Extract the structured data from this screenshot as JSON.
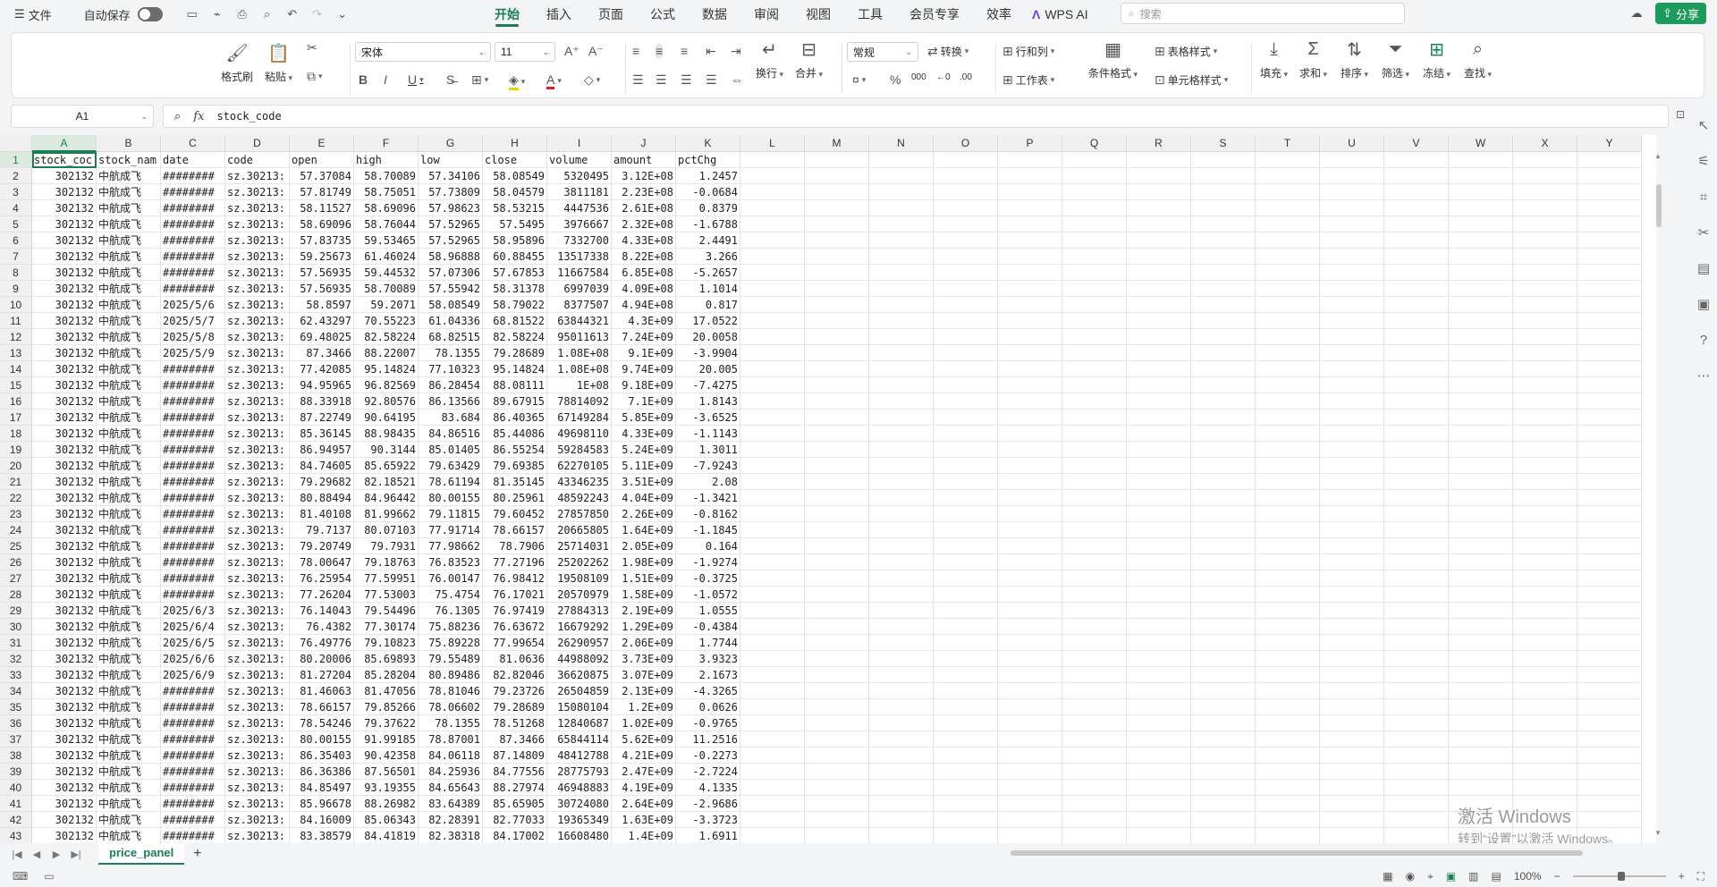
{
  "titlebar": {
    "file_menu": "文件",
    "autosave_label": "自动保存",
    "tabs": [
      "开始",
      "插入",
      "页面",
      "公式",
      "数据",
      "审阅",
      "视图",
      "工具",
      "会员专享",
      "效率"
    ],
    "wps_ai": "WPS AI",
    "search_placeholder": "搜索",
    "share": "分享"
  },
  "ribbon": {
    "format_painter": "格式刷",
    "paste": "粘贴",
    "font_name": "宋体",
    "font_size": "11",
    "bold": "B",
    "italic": "I",
    "underline": "U",
    "wrap": "换行",
    "merge": "合并",
    "number_format": "常规",
    "convert": "转换",
    "rows_cols": "行和列",
    "worksheet": "工作表",
    "table_style": "表格样式",
    "cond_format": "条件格式",
    "cell_style": "单元格样式",
    "fill": "填充",
    "sum": "求和",
    "sort": "排序",
    "filter": "筛选",
    "freeze": "冻结",
    "find": "查找",
    "percent": "%",
    "thousands": "000"
  },
  "formula_bar": {
    "cell_ref": "A1",
    "fx": "fx",
    "value": "stock_code"
  },
  "columns": [
    "A",
    "B",
    "C",
    "D",
    "E",
    "F",
    "G",
    "H",
    "I",
    "J",
    "K",
    "L",
    "M",
    "N",
    "O",
    "P",
    "Q",
    "R",
    "S",
    "T",
    "U",
    "V",
    "W",
    "X",
    "Y"
  ],
  "rows": [
    [
      "stock_coc",
      "stock_nam",
      "date",
      "code",
      "open",
      "high",
      "low",
      "close",
      "volume",
      "amount",
      "pctChg"
    ],
    [
      "302132",
      "中航成飞",
      "########",
      "sz.30213:",
      "57.37084",
      "58.70089",
      "57.34106",
      "58.08549",
      "5320495",
      "3.12E+08",
      "1.2457"
    ],
    [
      "302132",
      "中航成飞",
      "########",
      "sz.30213:",
      "57.81749",
      "58.75051",
      "57.73809",
      "58.04579",
      "3811181",
      "2.23E+08",
      "-0.0684"
    ],
    [
      "302132",
      "中航成飞",
      "########",
      "sz.30213:",
      "58.11527",
      "58.69096",
      "57.98623",
      "58.53215",
      "4447536",
      "2.61E+08",
      "0.8379"
    ],
    [
      "302132",
      "中航成飞",
      "########",
      "sz.30213:",
      "58.69096",
      "58.76044",
      "57.52965",
      "57.5495",
      "3976667",
      "2.32E+08",
      "-1.6788"
    ],
    [
      "302132",
      "中航成飞",
      "########",
      "sz.30213:",
      "57.83735",
      "59.53465",
      "57.52965",
      "58.95896",
      "7332700",
      "4.33E+08",
      "2.4491"
    ],
    [
      "302132",
      "中航成飞",
      "########",
      "sz.30213:",
      "59.25673",
      "61.46024",
      "58.96888",
      "60.88455",
      "13517338",
      "8.22E+08",
      "3.266"
    ],
    [
      "302132",
      "中航成飞",
      "########",
      "sz.30213:",
      "57.56935",
      "59.44532",
      "57.07306",
      "57.67853",
      "11667584",
      "6.85E+08",
      "-5.2657"
    ],
    [
      "302132",
      "中航成飞",
      "########",
      "sz.30213:",
      "57.56935",
      "58.70089",
      "57.55942",
      "58.31378",
      "6997039",
      "4.09E+08",
      "1.1014"
    ],
    [
      "302132",
      "中航成飞",
      "2025/5/6",
      "sz.30213:",
      "58.8597",
      "59.2071",
      "58.08549",
      "58.79022",
      "8377507",
      "4.94E+08",
      "0.817"
    ],
    [
      "302132",
      "中航成飞",
      "2025/5/7",
      "sz.30213:",
      "62.43297",
      "70.55223",
      "61.04336",
      "68.81522",
      "63844321",
      "4.3E+09",
      "17.0522"
    ],
    [
      "302132",
      "中航成飞",
      "2025/5/8",
      "sz.30213:",
      "69.48025",
      "82.58224",
      "68.82515",
      "82.58224",
      "95011613",
      "7.24E+09",
      "20.0058"
    ],
    [
      "302132",
      "中航成飞",
      "2025/5/9",
      "sz.30213:",
      "87.3466",
      "88.22007",
      "78.1355",
      "79.28689",
      "1.08E+08",
      "9.1E+09",
      "-3.9904"
    ],
    [
      "302132",
      "中航成飞",
      "########",
      "sz.30213:",
      "77.42085",
      "95.14824",
      "77.10323",
      "95.14824",
      "1.08E+08",
      "9.74E+09",
      "20.005"
    ],
    [
      "302132",
      "中航成飞",
      "########",
      "sz.30213:",
      "94.95965",
      "96.82569",
      "86.28454",
      "88.08111",
      "1E+08",
      "9.18E+09",
      "-7.4275"
    ],
    [
      "302132",
      "中航成飞",
      "########",
      "sz.30213:",
      "88.33918",
      "92.80576",
      "86.13566",
      "89.67915",
      "78814092",
      "7.1E+09",
      "1.8143"
    ],
    [
      "302132",
      "中航成飞",
      "########",
      "sz.30213:",
      "87.22749",
      "90.64195",
      "83.684",
      "86.40365",
      "67149284",
      "5.85E+09",
      "-3.6525"
    ],
    [
      "302132",
      "中航成飞",
      "########",
      "sz.30213:",
      "85.36145",
      "88.98435",
      "84.86516",
      "85.44086",
      "49698110",
      "4.33E+09",
      "-1.1143"
    ],
    [
      "302132",
      "中航成飞",
      "########",
      "sz.30213:",
      "86.94957",
      "90.3144",
      "85.01405",
      "86.55254",
      "59284583",
      "5.24E+09",
      "1.3011"
    ],
    [
      "302132",
      "中航成飞",
      "########",
      "sz.30213:",
      "84.74605",
      "85.65922",
      "79.63429",
      "79.69385",
      "62270105",
      "5.11E+09",
      "-7.9243"
    ],
    [
      "302132",
      "中航成飞",
      "########",
      "sz.30213:",
      "79.29682",
      "82.18521",
      "78.61194",
      "81.35145",
      "43346235",
      "3.51E+09",
      "2.08"
    ],
    [
      "302132",
      "中航成飞",
      "########",
      "sz.30213:",
      "80.88494",
      "84.96442",
      "80.00155",
      "80.25961",
      "48592243",
      "4.04E+09",
      "-1.3421"
    ],
    [
      "302132",
      "中航成飞",
      "########",
      "sz.30213:",
      "81.40108",
      "81.99662",
      "79.11815",
      "79.60452",
      "27857850",
      "2.26E+09",
      "-0.8162"
    ],
    [
      "302132",
      "中航成飞",
      "########",
      "sz.30213:",
      "79.7137",
      "80.07103",
      "77.91714",
      "78.66157",
      "20665805",
      "1.64E+09",
      "-1.1845"
    ],
    [
      "302132",
      "中航成飞",
      "########",
      "sz.30213:",
      "79.20749",
      "79.7931",
      "77.98662",
      "78.7906",
      "25714031",
      "2.05E+09",
      "0.164"
    ],
    [
      "302132",
      "中航成飞",
      "########",
      "sz.30213:",
      "78.00647",
      "79.18763",
      "76.83523",
      "77.27196",
      "25202262",
      "1.98E+09",
      "-1.9274"
    ],
    [
      "302132",
      "中航成飞",
      "########",
      "sz.30213:",
      "76.25954",
      "77.59951",
      "76.00147",
      "76.98412",
      "19508109",
      "1.51E+09",
      "-0.3725"
    ],
    [
      "302132",
      "中航成飞",
      "########",
      "sz.30213:",
      "77.26204",
      "77.53003",
      "75.4754",
      "76.17021",
      "20570979",
      "1.58E+09",
      "-1.0572"
    ],
    [
      "302132",
      "中航成飞",
      "2025/6/3",
      "sz.30213:",
      "76.14043",
      "79.54496",
      "76.1305",
      "76.97419",
      "27884313",
      "2.19E+09",
      "1.0555"
    ],
    [
      "302132",
      "中航成飞",
      "2025/6/4",
      "sz.30213:",
      "76.4382",
      "77.30174",
      "75.88236",
      "76.63672",
      "16679292",
      "1.29E+09",
      "-0.4384"
    ],
    [
      "302132",
      "中航成飞",
      "2025/6/5",
      "sz.30213:",
      "76.49776",
      "79.10823",
      "75.89228",
      "77.99654",
      "26290957",
      "2.06E+09",
      "1.7744"
    ],
    [
      "302132",
      "中航成飞",
      "2025/6/6",
      "sz.30213:",
      "80.20006",
      "85.69893",
      "79.55489",
      "81.0636",
      "44988092",
      "3.73E+09",
      "3.9323"
    ],
    [
      "302132",
      "中航成飞",
      "2025/6/9",
      "sz.30213:",
      "81.27204",
      "85.28204",
      "80.89486",
      "82.82046",
      "36620875",
      "3.07E+09",
      "2.1673"
    ],
    [
      "302132",
      "中航成飞",
      "########",
      "sz.30213:",
      "81.46063",
      "81.47056",
      "78.81046",
      "79.23726",
      "26504859",
      "2.13E+09",
      "-4.3265"
    ],
    [
      "302132",
      "中航成飞",
      "########",
      "sz.30213:",
      "78.66157",
      "79.85266",
      "78.06602",
      "79.28689",
      "15080104",
      "1.2E+09",
      "0.0626"
    ],
    [
      "302132",
      "中航成飞",
      "########",
      "sz.30213:",
      "78.54246",
      "79.37622",
      "78.1355",
      "78.51268",
      "12840687",
      "1.02E+09",
      "-0.9765"
    ],
    [
      "302132",
      "中航成飞",
      "########",
      "sz.30213:",
      "80.00155",
      "91.99185",
      "78.87001",
      "87.3466",
      "65844114",
      "5.62E+09",
      "11.2516"
    ],
    [
      "302132",
      "中航成飞",
      "########",
      "sz.30213:",
      "86.35403",
      "90.42358",
      "84.06118",
      "87.14809",
      "48412788",
      "4.21E+09",
      "-0.2273"
    ],
    [
      "302132",
      "中航成飞",
      "########",
      "sz.30213:",
      "86.36386",
      "87.56501",
      "84.25936",
      "84.77556",
      "28775793",
      "2.47E+09",
      "-2.7224"
    ],
    [
      "302132",
      "中航成飞",
      "########",
      "sz.30213:",
      "84.85497",
      "93.19355",
      "84.65643",
      "88.27974",
      "46948883",
      "4.19E+09",
      "4.1335"
    ],
    [
      "302132",
      "中航成飞",
      "########",
      "sz.30213:",
      "85.96678",
      "88.26982",
      "83.64389",
      "85.65905",
      "30724080",
      "2.64E+09",
      "-2.9686"
    ],
    [
      "302132",
      "中航成飞",
      "########",
      "sz.30213:",
      "84.16009",
      "85.06343",
      "82.28391",
      "82.77033",
      "19365349",
      "1.63E+09",
      "-3.3723"
    ],
    [
      "302132",
      "中航成飞",
      "########",
      "sz.30213:",
      "83.38579",
      "84.41819",
      "82.38318",
      "84.17002",
      "16608480",
      "1.4E+09",
      "1.6911"
    ]
  ],
  "sheet": {
    "name": "price_panel"
  },
  "status": {
    "zoom": "100%"
  },
  "watermark": {
    "line1": "激活 Windows",
    "line2": "转到“设置”以激活 Windows。"
  },
  "colors": {
    "accent": "#1a7f52",
    "share_bg": "#1d9b5c"
  }
}
